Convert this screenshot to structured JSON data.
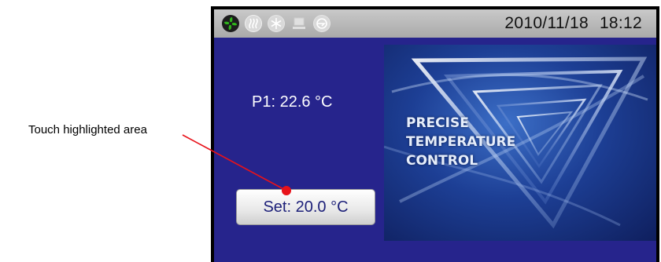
{
  "annotation": {
    "label": "Touch highlighted area",
    "color": "#e8121a"
  },
  "status_bar": {
    "icons": [
      "fan-icon",
      "heater-icon",
      "snowflake-icon",
      "network-icon",
      "pump-icon"
    ],
    "date": "2010/11/18",
    "time": "18:12"
  },
  "main": {
    "probe_reading": "P1: 22.6 °C",
    "setpoint_button": "Set: 20.0 °C"
  },
  "hero": {
    "lines": [
      "PRECISE",
      "TEMPERATURE",
      "CONTROL"
    ]
  },
  "colors": {
    "screen_bg": "#26248c",
    "status_bar_bg": "#b8b8b8",
    "fan_icon": "#2fb51b",
    "button_text": "#1d2079"
  }
}
